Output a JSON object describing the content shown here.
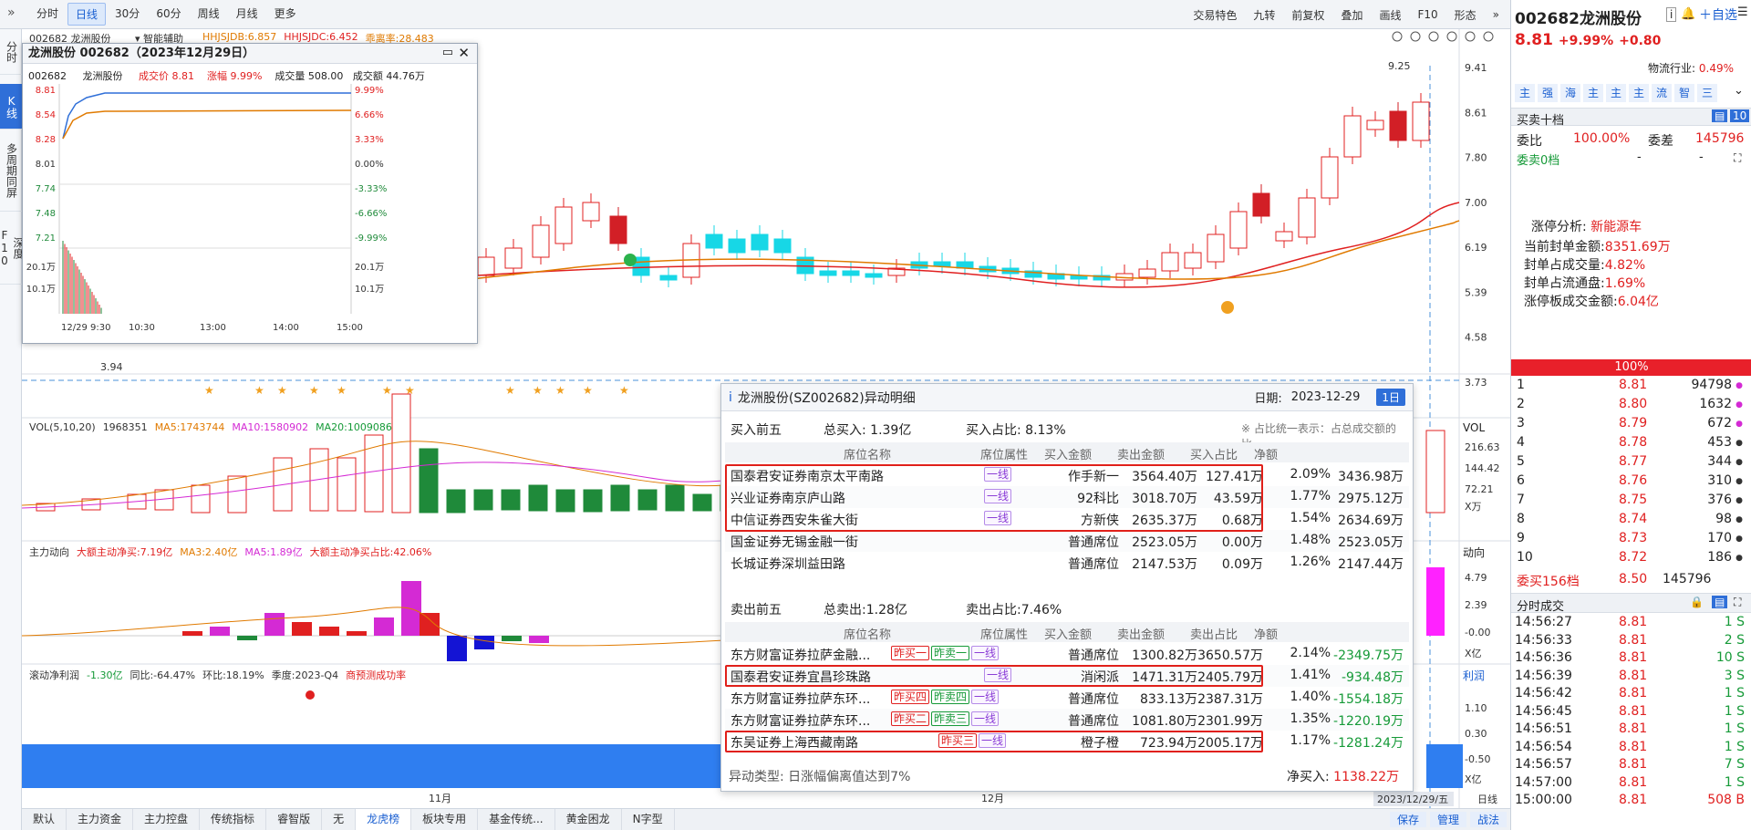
{
  "toolbar": {
    "periods": [
      "分时",
      "日线",
      "30分",
      "60分",
      "周线",
      "月线",
      "更多"
    ],
    "active_period": "日线",
    "right_items": [
      "交易特色",
      "九转",
      "前复权",
      "叠加",
      "画线",
      "F10",
      "形态"
    ]
  },
  "left_tabs": [
    "分时",
    "K线",
    "多周期同屏",
    "深度F10"
  ],
  "chart": {
    "stock_label": "002682 龙洲股份",
    "smart_assist": "智能辅助",
    "indicators": [
      {
        "text": "HHJSJDB:6.857",
        "color": "#e07a00"
      },
      {
        "text": "HHJSJDC:6.452",
        "color": "#e02020"
      },
      {
        "text": "乖离率:28.483",
        "color": "#e07a00"
      }
    ],
    "price_axis": [
      "9.41",
      "8.61",
      "7.80",
      "7.00",
      "6.19",
      "5.39",
      "4.58",
      "3.73"
    ],
    "high_mark": "9.25",
    "low_mark": "3.94",
    "vol_header": [
      {
        "text": "VOL(5,10,20)",
        "color": "#333"
      },
      {
        "text": "1968351",
        "color": "#333"
      },
      {
        "text": "MA5:1743744",
        "color": "#e07a00"
      },
      {
        "text": "MA10:1580902",
        "color": "#d42ad4"
      },
      {
        "text": "MA20:1009086",
        "color": "#169a38"
      }
    ],
    "vol_axis": [
      "216.63",
      "144.42",
      "72.21",
      "X万"
    ],
    "flow_header": [
      {
        "text": "主力动向",
        "color": "#333"
      },
      {
        "text": "大额主动净买:7.19亿",
        "color": "#e02020"
      },
      {
        "text": "MA3:2.40亿",
        "color": "#e07a00"
      },
      {
        "text": "MA5:1.89亿",
        "color": "#d42ad4"
      },
      {
        "text": "大额主动净买占比:42.06%",
        "color": "#e02020"
      }
    ],
    "flow_axis": [
      "4.79",
      "2.39",
      "-0.00",
      "X亿"
    ],
    "profit_header": [
      {
        "text": "滚动净利润",
        "color": "#333"
      },
      {
        "text": "-1.30亿",
        "color": "#169a38"
      },
      {
        "text": "同比:-64.47%",
        "color": "#333"
      },
      {
        "text": "环比:18.19%",
        "color": "#333"
      },
      {
        "text": "季度:2023-Q4",
        "color": "#333"
      },
      {
        "text": "商预测成功率",
        "color": "#e02020"
      }
    ],
    "profit_axis": [
      "1.10",
      "0.30",
      "-0.50",
      "X亿"
    ],
    "x_labels": [
      "11月",
      "12月"
    ],
    "date_label": "2023/12/29/五",
    "period_word": "日线"
  },
  "bottom_tabs": [
    "默认",
    "主力资金",
    "主力控盘",
    "传统指标",
    "睿智版",
    "无",
    "龙虎榜",
    "板块专用",
    "基金传统...",
    "黄金困龙",
    "N字型"
  ],
  "bottom_active": "龙虎榜",
  "bottom_right": [
    "保存",
    "管理",
    "战法"
  ],
  "intraday": {
    "title": "龙洲股份 002682（2023年12月29日）",
    "code": "002682",
    "name": "龙洲股份",
    "price_label": "成交价",
    "price": "8.81",
    "change_label": "涨幅",
    "change": "9.99%",
    "volume_label": "成交量",
    "volume": "508.00",
    "amount_label": "成交额",
    "amount": "44.76万",
    "left_axis": [
      "8.81",
      "8.54",
      "8.28",
      "8.01",
      "7.74",
      "7.48",
      "7.21",
      "20.1万",
      "10.1万"
    ],
    "right_axis": [
      "9.99%",
      "6.66%",
      "3.33%",
      "0.00%",
      "-3.33%",
      "-6.66%",
      "-9.99%",
      "20.1万",
      "10.1万"
    ],
    "time_axis": [
      "12/29 9:30",
      "10:30",
      "13:00",
      "14:00",
      "15:00"
    ]
  },
  "detail": {
    "title": "龙洲股份(SZ002682)异动明细",
    "date_label": "日期:",
    "date": "2023-12-29",
    "period_button": "1日",
    "buy_section": "买入前五",
    "total_buy": "总买入: 1.39亿",
    "buy_ratio": "买入占比: 8.13%",
    "note": "※ 占比统一表示：占总成交额的比",
    "buy_headers": [
      "席位名称",
      "席位属性",
      "买入金额",
      "卖出金额",
      "买入占比",
      "净额"
    ],
    "buy_rows": [
      {
        "name": "国泰君安证券南京太平南路",
        "tags": [
          {
            "t": "一线",
            "c": "purple"
          }
        ],
        "attr": "作手新一",
        "buy": "3564.40万",
        "sell": "127.41万",
        "ratio": "2.09%",
        "net": "3436.98万"
      },
      {
        "name": "兴业证券南京庐山路",
        "tags": [
          {
            "t": "一线",
            "c": "purple"
          }
        ],
        "attr": "92科比",
        "buy": "3018.70万",
        "sell": "43.59万",
        "ratio": "1.77%",
        "net": "2975.12万"
      },
      {
        "name": "中信证券西安朱雀大街",
        "tags": [
          {
            "t": "一线",
            "c": "purple"
          }
        ],
        "attr": "方新侠",
        "buy": "2635.37万",
        "sell": "0.68万",
        "ratio": "1.54%",
        "net": "2634.69万"
      },
      {
        "name": "国金证券无锡金融一街",
        "tags": [],
        "attr": "普通席位",
        "buy": "2523.05万",
        "sell": "0.00万",
        "ratio": "1.48%",
        "net": "2523.05万"
      },
      {
        "name": "长城证券深圳益田路",
        "tags": [],
        "attr": "普通席位",
        "buy": "2147.53万",
        "sell": "0.09万",
        "ratio": "1.26%",
        "net": "2147.44万"
      }
    ],
    "sell_section": "卖出前五",
    "total_sell": "总卖出:1.28亿",
    "sell_ratio": "卖出占比:7.46%",
    "sell_headers": [
      "席位名称",
      "席位属性",
      "买入金额",
      "卖出金额",
      "卖出占比",
      "净额"
    ],
    "sell_rows": [
      {
        "name": "东方财富证券拉萨金融...",
        "tags": [
          {
            "t": "昨买一",
            "c": "red"
          },
          {
            "t": "昨卖一",
            "c": "green"
          },
          {
            "t": "一线",
            "c": "purple"
          }
        ],
        "attr": "普通席位",
        "buy": "1300.82万",
        "sell": "3650.57万",
        "ratio": "2.14%",
        "net": "-2349.75万"
      },
      {
        "name": "国泰君安证券宜昌珍珠路",
        "tags": [
          {
            "t": "一线",
            "c": "purple"
          }
        ],
        "attr": "消闲派",
        "buy": "1471.31万",
        "sell": "2405.79万",
        "ratio": "1.41%",
        "net": "-934.48万"
      },
      {
        "name": "东方财富证券拉萨东环...",
        "tags": [
          {
            "t": "昨买四",
            "c": "red"
          },
          {
            "t": "昨卖四",
            "c": "green"
          },
          {
            "t": "一线",
            "c": "purple"
          }
        ],
        "attr": "普通席位",
        "buy": "833.13万",
        "sell": "2387.31万",
        "ratio": "1.40%",
        "net": "-1554.18万"
      },
      {
        "name": "东方财富证券拉萨东环...",
        "tags": [
          {
            "t": "昨买二",
            "c": "red"
          },
          {
            "t": "昨卖三",
            "c": "green"
          },
          {
            "t": "一线",
            "c": "purple"
          }
        ],
        "attr": "普通席位",
        "buy": "1081.80万",
        "sell": "2301.99万",
        "ratio": "1.35%",
        "net": "-1220.19万"
      },
      {
        "name": "东吴证券上海西藏南路",
        "tags": [
          {
            "t": "昨买三",
            "c": "red"
          },
          {
            "t": "一线",
            "c": "purple"
          }
        ],
        "attr": "橙子橙",
        "buy": "723.94万",
        "sell": "2005.17万",
        "ratio": "1.17%",
        "net": "-1281.24万"
      }
    ],
    "footer_type": "异动类型: 日涨幅偏离值达到7%",
    "footer_net_label": "净买入:",
    "footer_net": "1138.22万"
  },
  "right": {
    "code": "002682",
    "name": "龙洲股份",
    "fav": "自选",
    "price": "8.81",
    "change": "+9.99%",
    "change_abs": "+0.80",
    "industry": "物流行业:",
    "industry_pct": "0.49%",
    "func_buttons": [
      "主",
      "强",
      "海",
      "主",
      "主",
      "主",
      "流",
      "智",
      "三"
    ],
    "book_title": "买卖十档",
    "book_tag": "10",
    "weibi_label": "委比",
    "weibi": "100.00%",
    "weicha_label": "委差",
    "weicha": "145796",
    "sell0": "委卖0档",
    "sell0_a": "-",
    "sell0_b": "-",
    "limit_label": "涨停分析:",
    "limit_concept": "新能源车",
    "limit_items": [
      {
        "k": "当前封单金额:",
        "v": "8351.69万"
      },
      {
        "k": "封单占成交量:",
        "v": "4.82%"
      },
      {
        "k": "封单占流通盘:",
        "v": "1.69%"
      },
      {
        "k": "涨停板成交金额:",
        "v": "6.04亿"
      }
    ],
    "bar_pct": "100%",
    "bids": [
      {
        "n": "1",
        "p": "8.81",
        "v": "94798"
      },
      {
        "n": "2",
        "p": "8.80",
        "v": "1632"
      },
      {
        "n": "3",
        "p": "8.79",
        "v": "672"
      },
      {
        "n": "4",
        "p": "8.78",
        "v": "453"
      },
      {
        "n": "5",
        "p": "8.77",
        "v": "344"
      },
      {
        "n": "6",
        "p": "8.76",
        "v": "310"
      },
      {
        "n": "7",
        "p": "8.75",
        "v": "376"
      },
      {
        "n": "8",
        "p": "8.74",
        "v": "98"
      },
      {
        "n": "9",
        "p": "8.73",
        "v": "170"
      },
      {
        "n": "10",
        "p": "8.72",
        "v": "186"
      }
    ],
    "bid_total_label": "委买156档",
    "bid_total_p": "8.50",
    "bid_total_v": "145796",
    "ticks_title": "分时成交",
    "ticks": [
      {
        "t": "14:56:27",
        "p": "8.81",
        "v": "1 S"
      },
      {
        "t": "14:56:33",
        "p": "8.81",
        "v": "2 S"
      },
      {
        "t": "14:56:36",
        "p": "8.81",
        "v": "10 S"
      },
      {
        "t": "14:56:39",
        "p": "8.81",
        "v": "3 S"
      },
      {
        "t": "14:56:42",
        "p": "8.81",
        "v": "1 S"
      },
      {
        "t": "14:56:45",
        "p": "8.81",
        "v": "1 S"
      },
      {
        "t": "14:56:51",
        "p": "8.81",
        "v": "1 S"
      },
      {
        "t": "14:56:54",
        "p": "8.81",
        "v": "1 S"
      },
      {
        "t": "14:56:57",
        "p": "8.81",
        "v": "7 S"
      },
      {
        "t": "14:57:00",
        "p": "8.81",
        "v": "1 S"
      },
      {
        "t": "15:00:00",
        "p": "8.81",
        "v": "508 B"
      }
    ]
  }
}
